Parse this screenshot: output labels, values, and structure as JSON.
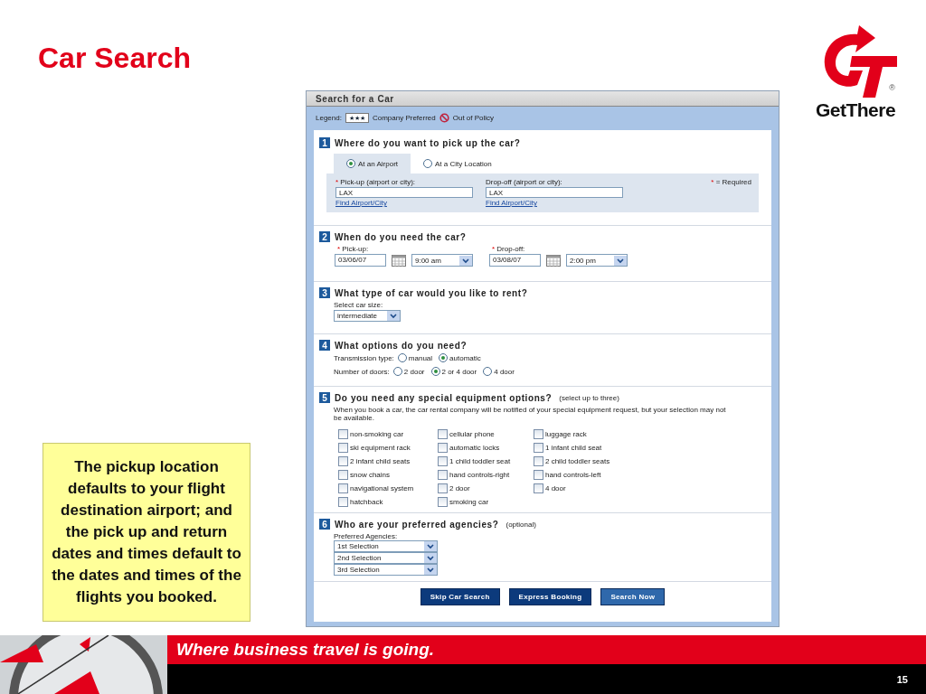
{
  "slide": {
    "title": "Car Search",
    "logo_text": "GetThere",
    "registered_mark": "®",
    "note": "The pickup location defaults to your flight destination airport; and the pick up and return dates and times default to the dates and times of the flights you booked.",
    "tagline": "Where business travel is going.",
    "page_number": "15"
  },
  "form": {
    "title": "Search for a Car",
    "required_mark": "*",
    "legend": {
      "label": "Legend:",
      "stars": "★★★",
      "preferred": "Company Preferred",
      "out_of_policy": "Out of Policy"
    },
    "sections": [
      {
        "kind": "location",
        "number": "1",
        "question": "Where do you want to pick up the car?",
        "tabs": [
          {
            "label": "At an Airport",
            "selected": true
          },
          {
            "label": "At a City Location",
            "selected": false
          }
        ],
        "fields": [
          {
            "label": "Pick-up (airport or city):",
            "required": true,
            "value": "LAX",
            "link": "Find Airport/City"
          },
          {
            "label": "Drop-off (airport or city):",
            "required": false,
            "value": "LAX",
            "link": "Find Airport/City"
          }
        ],
        "required_note": "= Required"
      },
      {
        "kind": "dates",
        "number": "2",
        "question": "When do you need the car?",
        "groups": [
          {
            "label": "Pick-up:",
            "required": true,
            "date": "03/06/07",
            "time": "9:00 am"
          },
          {
            "label": "Drop-off:",
            "required": true,
            "date": "03/08/07",
            "time": "2:00 pm"
          }
        ]
      },
      {
        "kind": "car_type",
        "number": "3",
        "question": "What type of car would you like to rent?",
        "label": "Select car size:",
        "value": "intermediate"
      },
      {
        "kind": "options",
        "number": "4",
        "question": "What options do you need?",
        "groups": [
          {
            "label": "Transmission type:",
            "options": [
              {
                "label": "manual",
                "selected": false
              },
              {
                "label": "automatic",
                "selected": true
              }
            ]
          },
          {
            "label": "Number of doors:",
            "options": [
              {
                "label": "2 door",
                "selected": false
              },
              {
                "label": "2 or 4 door",
                "selected": true
              },
              {
                "label": "4 door",
                "selected": false
              }
            ]
          }
        ]
      },
      {
        "kind": "equipment",
        "number": "5",
        "question": "Do you need any special equipment options?",
        "hint": "(select up to three)",
        "description": "When you book a car, the car rental company will be notified of your special equipment request, but your selection may not be available.",
        "items": [
          {
            "label": "non-smoking car",
            "checked": false
          },
          {
            "label": "cellular phone",
            "checked": false
          },
          {
            "label": "luggage rack",
            "checked": false
          },
          {
            "label": "ski equipment rack",
            "checked": false
          },
          {
            "label": "automatic locks",
            "checked": false
          },
          {
            "label": "1 infant child seat",
            "checked": false
          },
          {
            "label": "2 infant child seats",
            "checked": false
          },
          {
            "label": "1 child toddler seat",
            "checked": false
          },
          {
            "label": "2 child toddler seats",
            "checked": false
          },
          {
            "label": "snow chains",
            "checked": false
          },
          {
            "label": "hand controls-right",
            "checked": false
          },
          {
            "label": "hand controls-left",
            "checked": false
          },
          {
            "label": "navigational system",
            "checked": false
          },
          {
            "label": "2 door",
            "checked": false
          },
          {
            "label": "4 door",
            "checked": false
          },
          {
            "label": "hatchback",
            "checked": false
          },
          {
            "label": "smoking car",
            "checked": false
          }
        ]
      },
      {
        "kind": "agencies",
        "number": "6",
        "question": "Who are your preferred agencies?",
        "hint": "(optional)",
        "label": "Preferred Agencies:",
        "selects": [
          "1st Selection",
          "2nd Selection",
          "3rd Selection"
        ]
      }
    ],
    "buttons": [
      {
        "label": "Skip Car Search",
        "kind": "dark"
      },
      {
        "label": "Express Booking",
        "kind": "dark"
      },
      {
        "label": "Search Now",
        "kind": "light"
      }
    ]
  }
}
